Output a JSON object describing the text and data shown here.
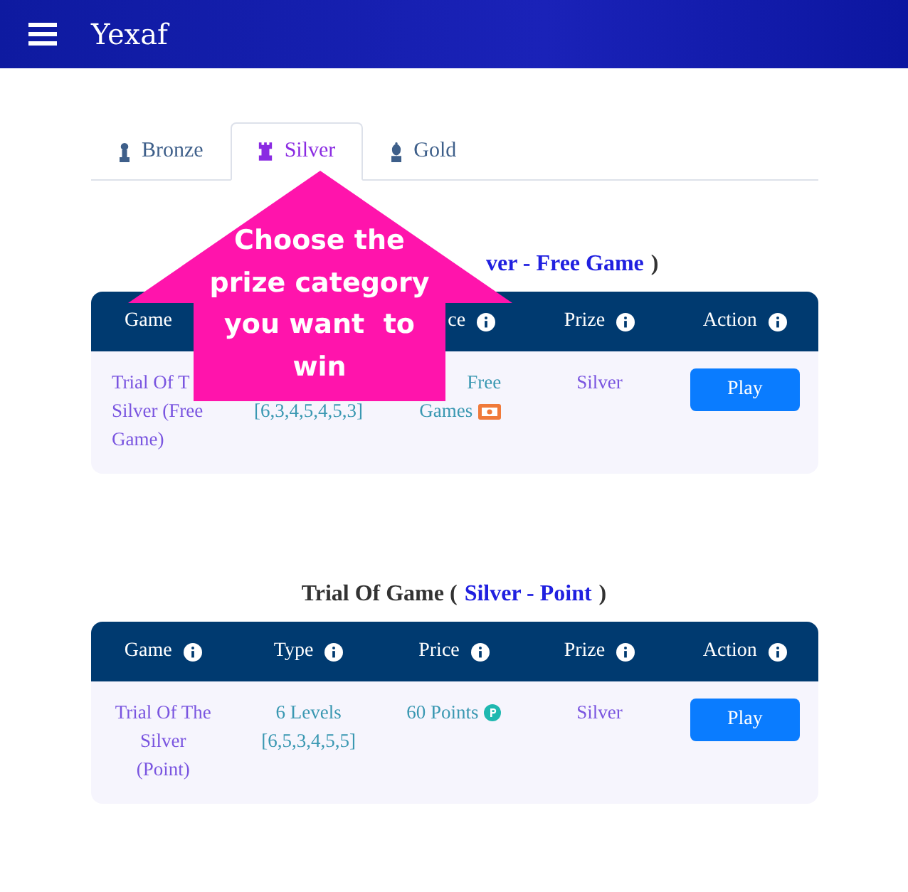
{
  "header": {
    "title": "Yexaf"
  },
  "tabs": [
    {
      "label": "Bronze",
      "selected": false
    },
    {
      "label": "Silver",
      "selected": true
    },
    {
      "label": "Gold",
      "selected": false
    }
  ],
  "callout": {
    "text": "Choose the prize category you want  to win"
  },
  "sections": [
    {
      "kind": "cut",
      "title": [
        {
          "kind": "link",
          "text": "ver - Free Game"
        },
        {
          "kind": "plain",
          "text": ")"
        }
      ],
      "columns": [
        {
          "kind": "label-only",
          "label": "Game"
        },
        {
          "kind": "hidden"
        },
        {
          "kind": "cut",
          "label": "ce"
        },
        {
          "kind": "full",
          "label": "Prize"
        },
        {
          "kind": "full",
          "label": "Action"
        }
      ],
      "cells": [
        {
          "kind": "game-cut",
          "lines": [
            "Trial Of T",
            "Silver (Free",
            "Game)"
          ]
        },
        {
          "kind": "type-cut",
          "lines": [
            "[6,3,4,5,4,5,3]"
          ]
        },
        {
          "kind": "price-cut",
          "lines": [
            "Free",
            "Games"
          ]
        },
        {
          "kind": "prize",
          "lines": [
            "Silver"
          ]
        },
        {
          "kind": "action",
          "label": "Play"
        }
      ]
    },
    {
      "kind": "full",
      "title": [
        {
          "kind": "plain",
          "text": "Trial Of Game ("
        },
        {
          "kind": "link",
          "text": "Silver - Point"
        },
        {
          "kind": "plain",
          "text": ")"
        }
      ],
      "columns": [
        {
          "kind": "full",
          "label": "Game"
        },
        {
          "kind": "full",
          "label": "Type"
        },
        {
          "kind": "full",
          "label": "Price"
        },
        {
          "kind": "full",
          "label": "Prize"
        },
        {
          "kind": "full",
          "label": "Action"
        }
      ],
      "cells": [
        {
          "kind": "game",
          "lines": [
            "Trial Of The",
            "Silver",
            "(Point)"
          ]
        },
        {
          "kind": "type",
          "lines": [
            "6 Levels",
            "[6,5,3,4,5,5]"
          ]
        },
        {
          "kind": "price",
          "lines": [
            "60 Points"
          ]
        },
        {
          "kind": "prize",
          "lines": [
            "Silver"
          ]
        },
        {
          "kind": "action",
          "label": "Play"
        }
      ]
    }
  ]
}
